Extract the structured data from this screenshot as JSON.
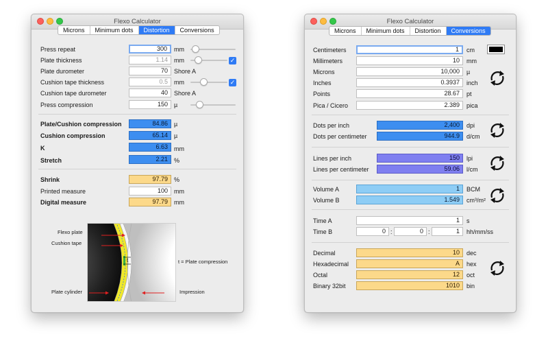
{
  "left_window": {
    "title": "Flexo Calculator",
    "tabs": [
      "Microns",
      "Minimum dots",
      "Distortion",
      "Conversions"
    ],
    "active_tab": "Distortion",
    "inputs": [
      {
        "label": "Press repeat",
        "value": "300",
        "unit": "mm"
      },
      {
        "label": "Plate thickness",
        "value": "1.14",
        "unit": "mm"
      },
      {
        "label": "Plate durometer",
        "value": "70",
        "unit": "Shore A"
      },
      {
        "label": "Cushion tape thickness",
        "value": "0.5",
        "unit": "mm"
      },
      {
        "label": "Cushion tape durometer",
        "value": "40",
        "unit": "Shore A"
      },
      {
        "label": "Press compression",
        "value": "150",
        "unit": "µ"
      }
    ],
    "results": [
      {
        "label": "Plate/Cushion compression",
        "value": "84.86",
        "unit": "µ"
      },
      {
        "label": "Cushion compression",
        "value": "65.14",
        "unit": "µ"
      },
      {
        "label": "K",
        "value": "6.63",
        "unit": "mm"
      },
      {
        "label": "Stretch",
        "value": "2.21",
        "unit": "%"
      }
    ],
    "shrink": [
      {
        "label": "Shrink",
        "value": "97.79",
        "unit": "%"
      },
      {
        "label": "Printed measure",
        "value": "100",
        "unit": "mm"
      },
      {
        "label": "Digital measure",
        "value": "97.79",
        "unit": "mm"
      }
    ],
    "checkmark": "✓",
    "diagram": {
      "flexo_plate": "Flexo plate",
      "cushion_tape": "Cushion tape",
      "plate_cylinder": "Plate cylinder",
      "impression": "Impression",
      "t_label": "t",
      "t_caption": "t = Plate compression"
    }
  },
  "right_window": {
    "title": "Flexo Calculator",
    "tabs": [
      "Microns",
      "Minimum dots",
      "Distortion",
      "Conversions"
    ],
    "active_tab": "Conversions",
    "length": [
      {
        "label": "Centimeters",
        "value": "1",
        "unit": "cm"
      },
      {
        "label": "Millimeters",
        "value": "10",
        "unit": "mm"
      },
      {
        "label": "Microns",
        "value": "10,000",
        "unit": "µ"
      },
      {
        "label": "Inches",
        "value": "0.3937",
        "unit": "inch"
      },
      {
        "label": "Points",
        "value": "28.67",
        "unit": "pt"
      },
      {
        "label": "Pica / Cicero",
        "value": "2.389",
        "unit": "pica"
      }
    ],
    "dots": [
      {
        "label": "Dots per inch",
        "value": "2,400",
        "unit": "dpi"
      },
      {
        "label": "Dots per centimeter",
        "value": "944.9",
        "unit": "d/cm"
      }
    ],
    "lines": [
      {
        "label": "Lines per inch",
        "value": "150",
        "unit": "lpi"
      },
      {
        "label": "Lines per centimeter",
        "value": "59.06",
        "unit": "l/cm"
      }
    ],
    "volume": [
      {
        "label": "Volume A",
        "value": "1",
        "unit": "BCM"
      },
      {
        "label": "Volume B",
        "value": "1.549",
        "unit": "cm³/m²"
      }
    ],
    "time": {
      "a_label": "Time A",
      "a_value": "1",
      "a_unit": "s",
      "b_label": "Time B",
      "b_h": "0",
      "b_m": "0",
      "b_s": "1",
      "b_unit": "hh/mm/ss",
      "colon": ":"
    },
    "number": [
      {
        "label": "Decimal",
        "value": "10",
        "unit": "dec"
      },
      {
        "label": "Hexadecimal",
        "value": "A",
        "unit": "hex"
      },
      {
        "label": "Octal",
        "value": "12",
        "unit": "oct"
      },
      {
        "label": "Binary 32bit",
        "value": "1010",
        "unit": "bin"
      }
    ]
  }
}
